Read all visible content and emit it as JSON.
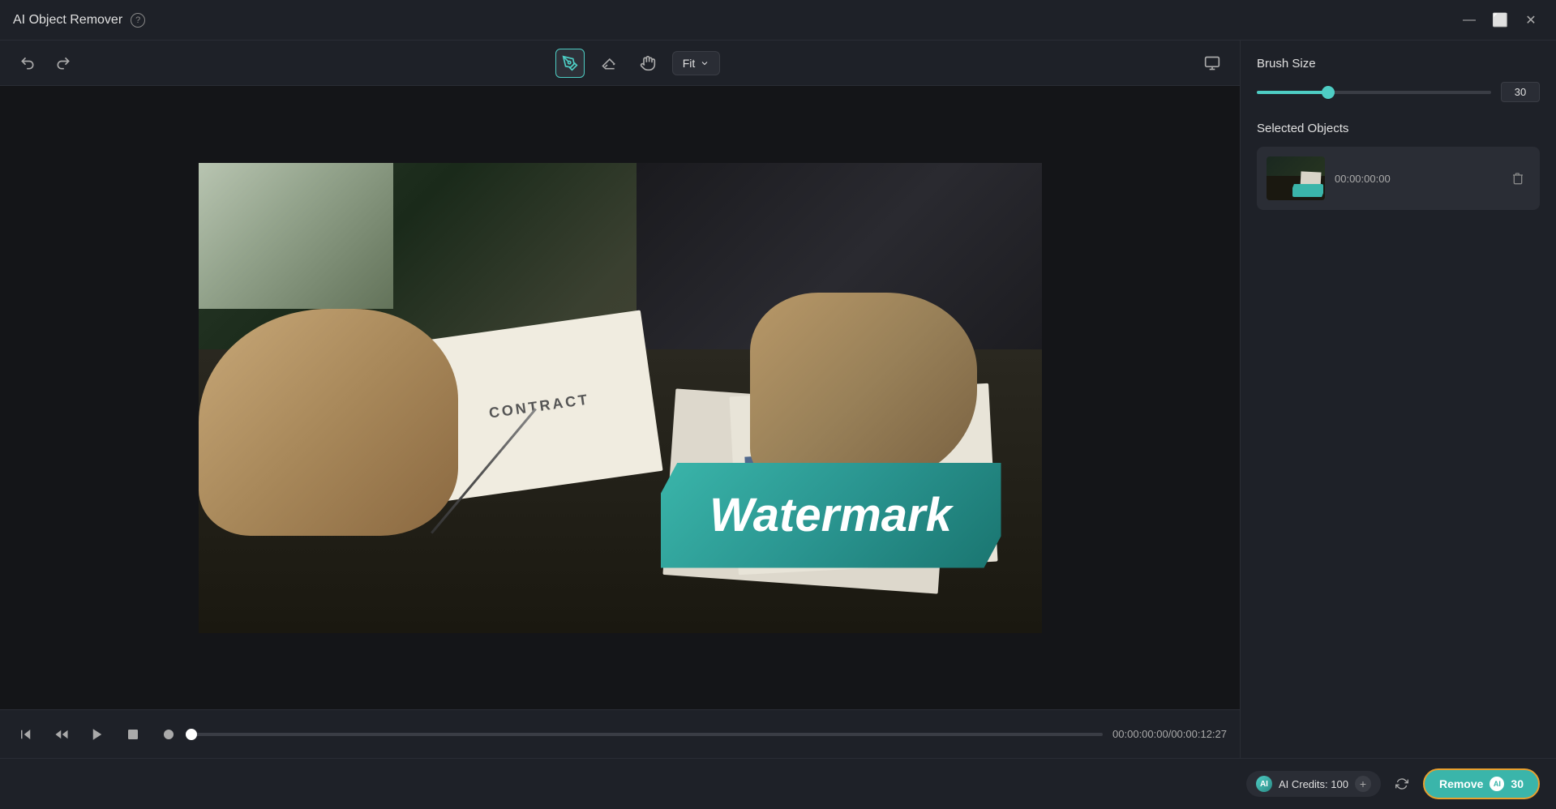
{
  "app": {
    "title": "AI Object Remover",
    "help_icon": "?",
    "window_controls": {
      "minimize": "—",
      "maximize": "⬜",
      "close": "✕"
    }
  },
  "toolbar": {
    "undo_label": "↩",
    "redo_label": "↪",
    "brush_label": "✏",
    "eraser_label": "◻",
    "pan_label": "✋",
    "fit_label": "Fit",
    "compare_label": "⊞"
  },
  "video": {
    "watermark_text": "Watermark",
    "contract_text": "CONTRACT"
  },
  "playback": {
    "skip_back": "⏮",
    "frame_back": "⏭",
    "play": "▶",
    "stop": "⬛",
    "record": "⏺",
    "time_display": "00:00:00:00/00:00:12:27"
  },
  "right_panel": {
    "brush_size": {
      "label": "Brush Size",
      "value": "30",
      "slider_value": 30
    },
    "selected_objects": {
      "label": "Selected Objects",
      "items": [
        {
          "timestamp": "00:00:00:00"
        }
      ]
    }
  },
  "bottom_bar": {
    "ai_credits_label": "AI Credits: 100",
    "remove_label": "Remove",
    "remove_credits": "30",
    "ai_text": "AI"
  }
}
